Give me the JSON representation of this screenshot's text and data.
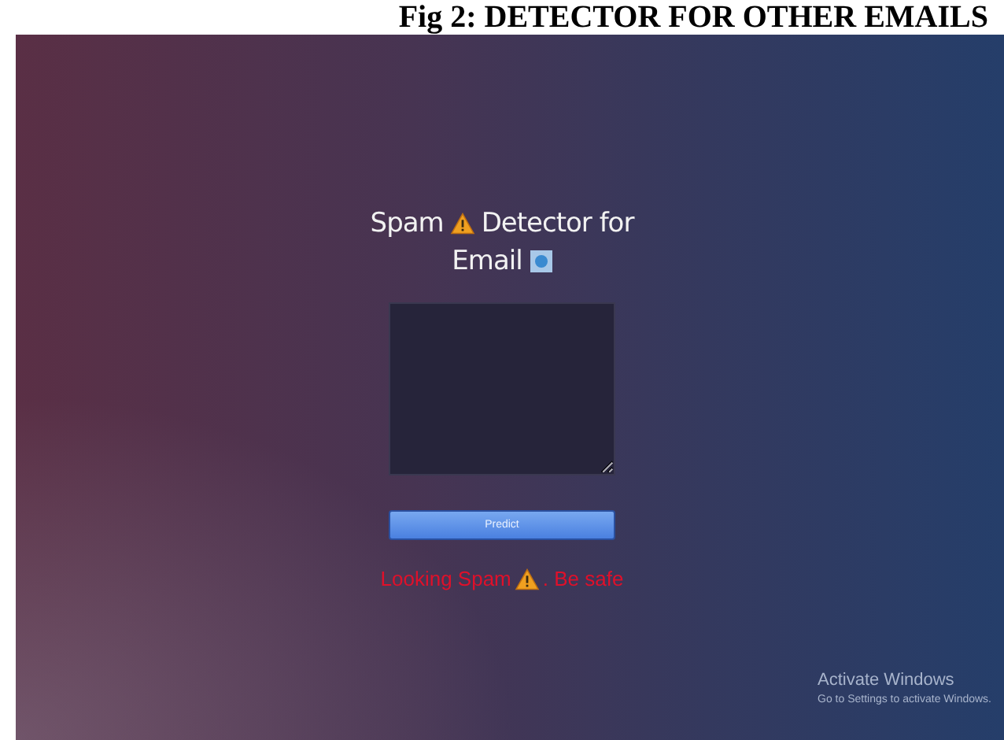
{
  "caption": "Fig 2: DETECTOR FOR OTHER EMAILS",
  "title": [
    "Spam",
    "Detector for",
    "Email"
  ],
  "predict_button": {
    "label": "Predict"
  },
  "result": [
    "Looking Spam",
    ". Be safe"
  ],
  "activation_notice": {
    "title": "Activate Windows",
    "subtitle": "Go to Settings to activate Windows."
  }
}
